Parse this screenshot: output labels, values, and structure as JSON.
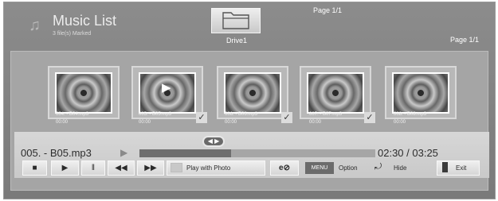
{
  "header": {
    "icon": "music-note-icon",
    "title": "Music List",
    "subtitle": "3 file(s) Marked",
    "page_top": "Page 1/1",
    "page_right": "Page 1/1",
    "drive": {
      "icon": "folder-icon",
      "label": "Drive1"
    }
  },
  "items": [
    {
      "name": "004. - B04.mp3",
      "time": "00:00",
      "marked": false,
      "playing": false
    },
    {
      "name": "005. - B05.mp3",
      "time": "00:00",
      "marked": true,
      "playing": true
    },
    {
      "name": "006. - B06.mp3",
      "time": "00:00",
      "marked": true,
      "playing": false
    },
    {
      "name": "007. - B07.mp3",
      "time": "00:00",
      "marked": true,
      "playing": false
    },
    {
      "name": "008. - B08.mp3",
      "time": "00:00",
      "marked": false,
      "playing": false
    }
  ],
  "player": {
    "current_file": "005. - B05.mp3",
    "time": "02:30 / 03:25",
    "progress_fraction": 0.39
  },
  "controls": {
    "stop_icon": "stop-icon",
    "play_icon": "play-icon",
    "pause_icon": "pause-icon",
    "rewind_icon": "rewind-icon",
    "forward_icon": "fast-forward-icon",
    "play_with_photo": "Play with Photo",
    "repeat_icon": "repeat-icon",
    "menu_label": "MENU",
    "option_label": "Option",
    "hide_label": "Hide",
    "exit_label": "Exit"
  }
}
